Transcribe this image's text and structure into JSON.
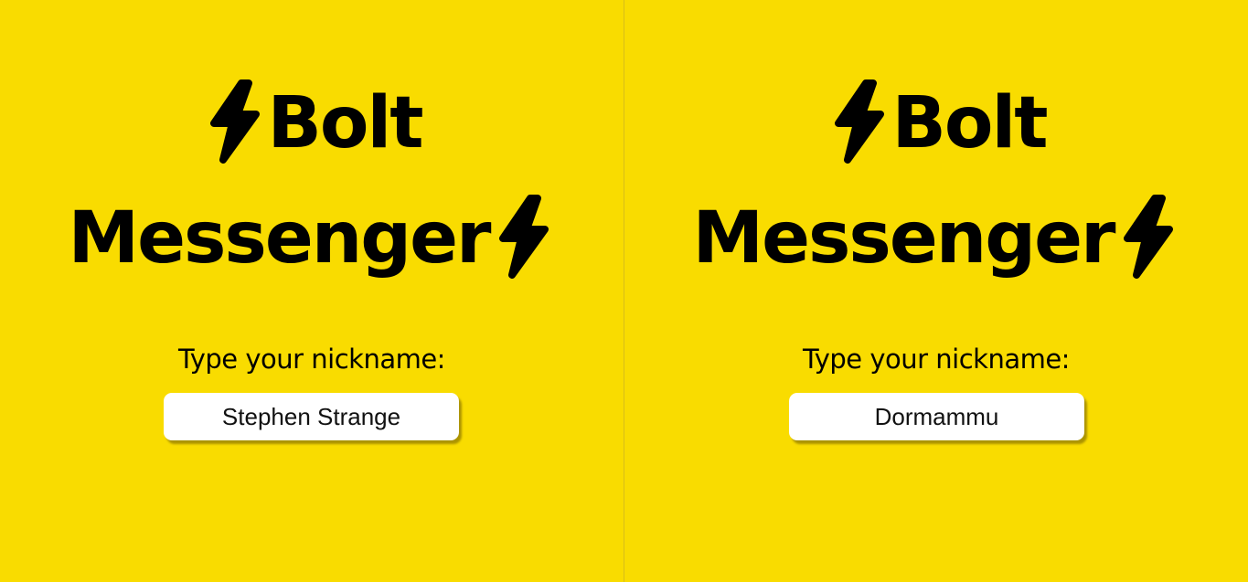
{
  "colors": {
    "background": "#F9DC00",
    "text": "#000000",
    "input_bg": "#FFFFFF"
  },
  "panes": [
    {
      "title_line1": "Bolt",
      "title_line2": "Messenger",
      "icon": "lightning-bolt-icon",
      "nickname_label": "Type your nickname:",
      "nickname_value": "Stephen Strange"
    },
    {
      "title_line1": "Bolt",
      "title_line2": "Messenger",
      "icon": "lightning-bolt-icon",
      "nickname_label": "Type your nickname:",
      "nickname_value": "Dormammu"
    }
  ]
}
